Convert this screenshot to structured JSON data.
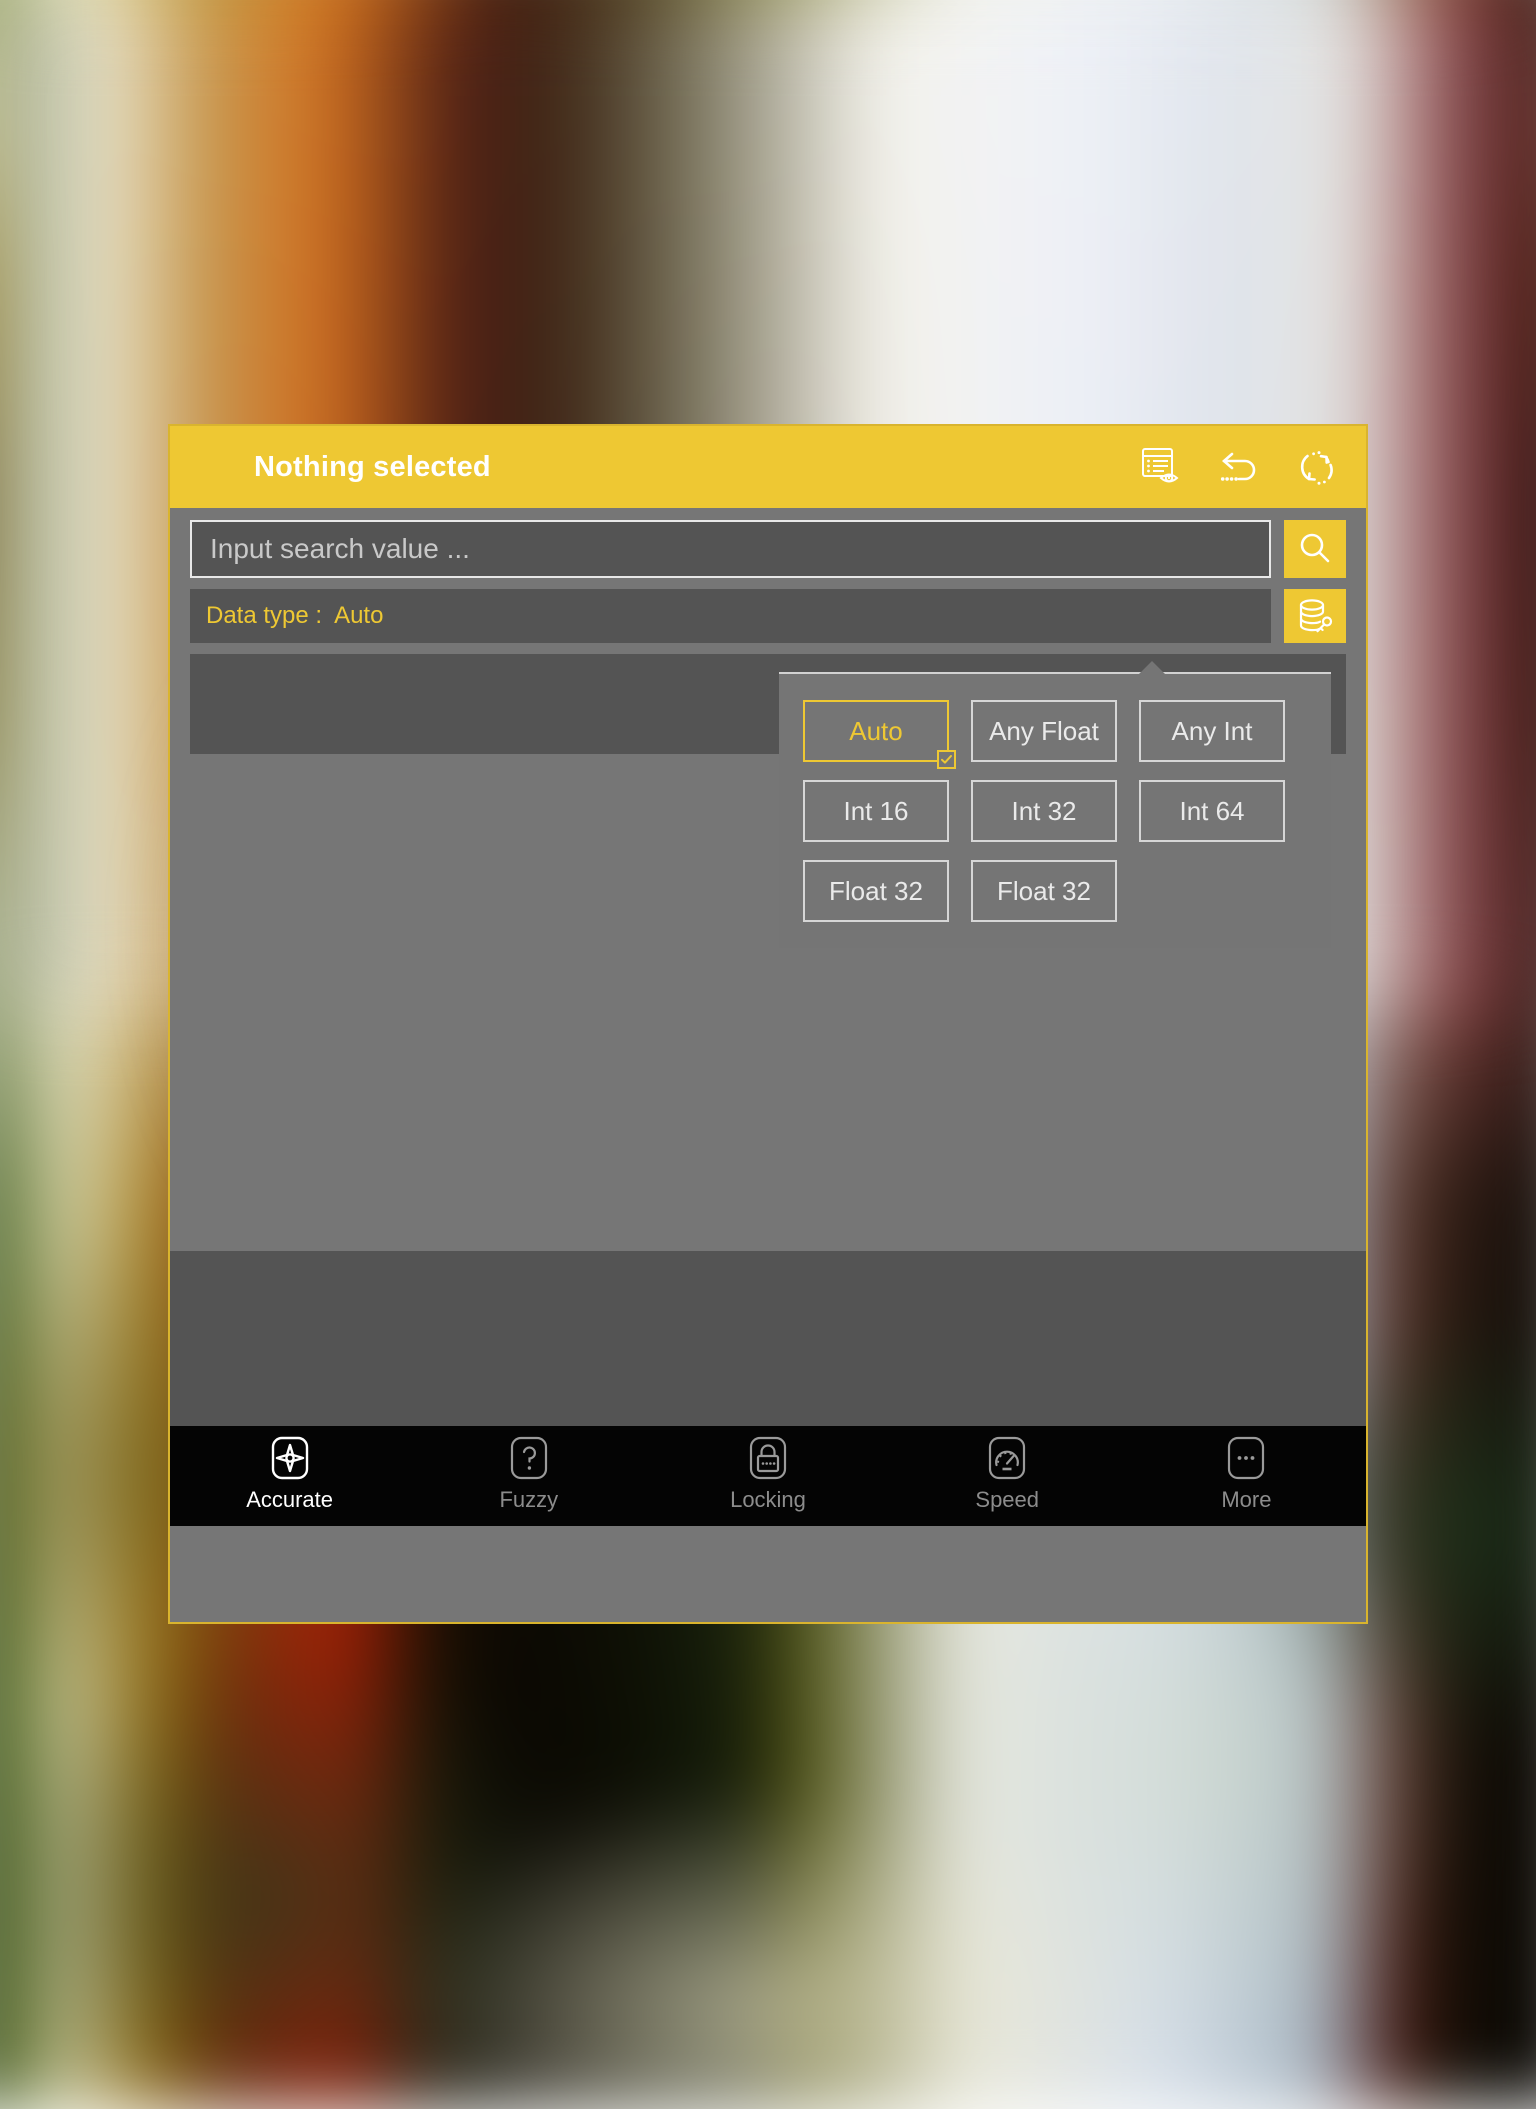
{
  "header": {
    "title": "Nothing selected",
    "tools": [
      {
        "icon": "list-with-eye-icon",
        "name": "view-records-button"
      },
      {
        "icon": "undo-dotted-arrow-icon",
        "name": "undo-button"
      },
      {
        "icon": "refresh-sync-icon",
        "name": "refresh-button"
      }
    ]
  },
  "search": {
    "placeholder": "Input search value ...",
    "value": "",
    "button_icon": "search-icon"
  },
  "datatype": {
    "label": "Data type :",
    "value": "Auto",
    "button_icon": "database-key-icon"
  },
  "datatype_popup": {
    "options": [
      {
        "label": "Auto",
        "selected": true
      },
      {
        "label": "Any Float",
        "selected": false
      },
      {
        "label": "Any Int",
        "selected": false
      },
      {
        "label": "Int 16",
        "selected": false
      },
      {
        "label": "Int 32",
        "selected": false
      },
      {
        "label": "Int 64",
        "selected": false
      },
      {
        "label": "Float 32",
        "selected": false
      },
      {
        "label": "Float 32",
        "selected": false
      }
    ]
  },
  "tabs": [
    {
      "label": "Accurate",
      "icon": "crosshair-diamond-icon",
      "active": true
    },
    {
      "label": "Fuzzy",
      "icon": "question-mark-icon",
      "active": false
    },
    {
      "label": "Locking",
      "icon": "padlock-dots-icon",
      "active": false
    },
    {
      "label": "Speed",
      "icon": "speedometer-icon",
      "active": false
    },
    {
      "label": "More",
      "icon": "ellipsis-icon",
      "active": false
    }
  ],
  "colors": {
    "accent_yellow": "#eec833",
    "panel_gray": "#767676",
    "field_gray": "#545454",
    "tabbar_black": "#040404",
    "border_light": "#d6d6d6"
  }
}
